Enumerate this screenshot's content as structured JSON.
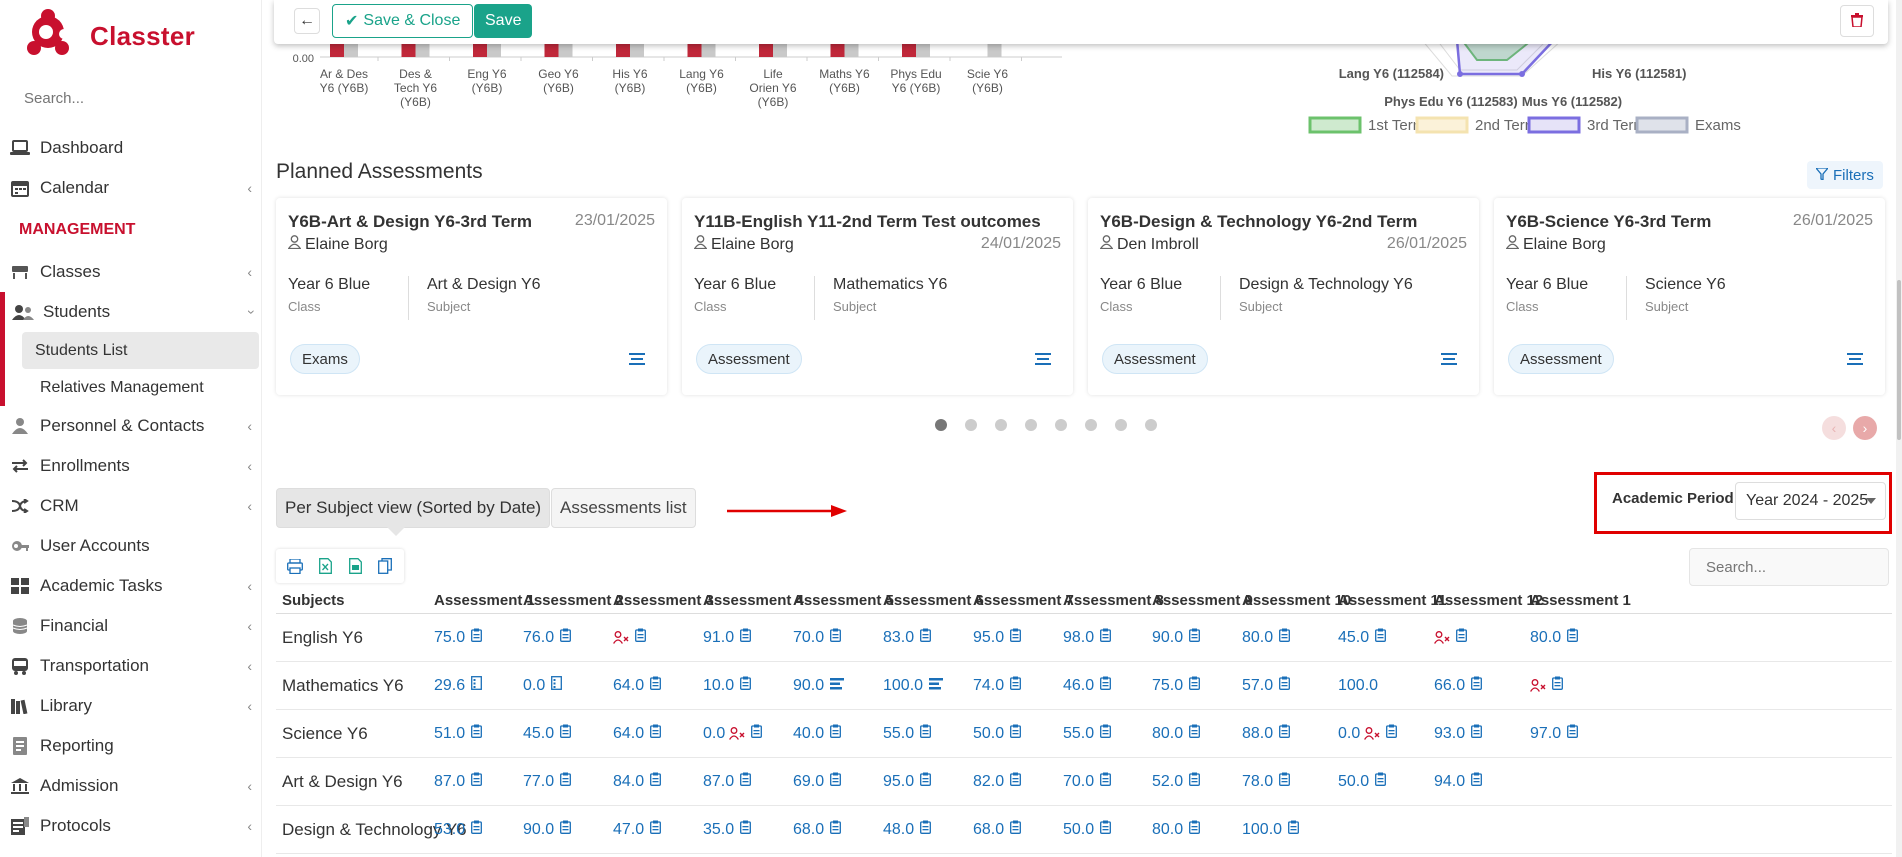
{
  "brand": {
    "name": "Classter"
  },
  "sidebar": {
    "search_placeholder": "Search...",
    "items": [
      {
        "label": "Dashboard",
        "icon": "laptop-icon",
        "chevron": false
      },
      {
        "label": "Calendar",
        "icon": "calendar-icon",
        "chevron": true
      }
    ],
    "section_label": "MANAGEMENT",
    "management_items": [
      {
        "label": "Classes",
        "icon": "chair-icon",
        "chevron": true
      },
      {
        "label": "Students",
        "icon": "users-icon",
        "chevron": true,
        "expanded": true
      },
      {
        "label": "Personnel & Contacts",
        "icon": "person-icon",
        "chevron": true
      },
      {
        "label": "Enrollments",
        "icon": "exchange-icon",
        "chevron": true
      },
      {
        "label": "CRM",
        "icon": "shuffle-icon",
        "chevron": true
      },
      {
        "label": "User Accounts",
        "icon": "key-icon",
        "chevron": false
      },
      {
        "label": "Academic Tasks",
        "icon": "grid-icon",
        "chevron": true
      },
      {
        "label": "Financial",
        "icon": "coins-icon",
        "chevron": true
      },
      {
        "label": "Transportation",
        "icon": "bus-icon",
        "chevron": true
      },
      {
        "label": "Library",
        "icon": "books-icon",
        "chevron": true
      },
      {
        "label": "Reporting",
        "icon": "report-icon",
        "chevron": false
      },
      {
        "label": "Admission",
        "icon": "institution-icon",
        "chevron": true
      },
      {
        "label": "Protocols",
        "icon": "protocol-icon",
        "chevron": true
      }
    ],
    "students_sub": [
      "Students List",
      "Relatives Management"
    ]
  },
  "toolbar": {
    "save_close_label": "Save & Close",
    "save_label": "Save"
  },
  "bar_chart": {
    "ytick": "0.00",
    "categories": [
      [
        "Ar & Des",
        "Y6 (Y6B)"
      ],
      [
        "Des &",
        "Tech Y6",
        "(Y6B)"
      ],
      [
        "Eng Y6",
        "(Y6B)"
      ],
      [
        "Geo Y6",
        "(Y6B)"
      ],
      [
        "His Y6",
        "(Y6B)"
      ],
      [
        "Lang Y6",
        "(Y6B)"
      ],
      [
        "Life",
        "Orien Y6",
        "(Y6B)"
      ],
      [
        "Maths Y6",
        "(Y6B)"
      ],
      [
        "Phys Edu",
        "Y6 (Y6B)"
      ],
      [
        "Scie Y6",
        "(Y6B)"
      ]
    ],
    "colors": {
      "red": "#c0283a",
      "grey": "#c9c9c9"
    }
  },
  "radar": {
    "labels": [
      "Lang Y6 (112584)",
      "His Y6 (112581)",
      "Phys Edu Y6 (112583)",
      "Mus Y6 (112582)"
    ],
    "legend": [
      {
        "label": "1st Term",
        "color": "#6cc26c",
        "fill": "#cfeacf"
      },
      {
        "label": "2nd Term",
        "color": "#f4e3b0",
        "fill": "#fbf2d9"
      },
      {
        "label": "3rd Term",
        "color": "#7b6ee0",
        "fill": "#e6e3f8"
      },
      {
        "label": "Exams",
        "color": "#a9b0c4",
        "fill": "#dfe2ea"
      }
    ]
  },
  "planned": {
    "title": "Planned Assessments",
    "filters_label": "Filters",
    "cards": [
      {
        "title": "Y6B-Art & Design Y6-3rd Term",
        "date": "23/01/2025",
        "teacher": "Elaine Borg",
        "class": "Year 6 Blue",
        "class_label": "Class",
        "subject": "Art & Design Y6",
        "subject_label": "Subject",
        "badge": "Exams"
      },
      {
        "title": "Y11B-English Y11-2nd Term Test outcomes",
        "date": "24/01/2025",
        "teacher": "Elaine Borg",
        "class": "Year 6 Blue",
        "class_label": "Class",
        "subject": "Mathematics Y6",
        "subject_label": "Subject",
        "badge": "Assessment"
      },
      {
        "title": "Y6B-Design & Technology Y6-2nd Term",
        "date": "26/01/2025",
        "teacher": "Den Imbroll",
        "class": "Year 6 Blue",
        "class_label": "Class",
        "subject": "Design & Technology Y6",
        "subject_label": "Subject",
        "badge": "Assessment"
      },
      {
        "title": "Y6B-Science Y6-3rd Term",
        "date": "26/01/2025",
        "teacher": "Elaine Borg",
        "class": "Year 6 Blue",
        "class_label": "Class",
        "subject": "Science Y6",
        "subject_label": "Subject",
        "badge": "Assessment"
      }
    ],
    "carousel_pages": 8,
    "carousel_active": 0,
    "prev_label": "‹",
    "next_label": "›"
  },
  "views": {
    "tab1": "Per Subject view (Sorted by Date)",
    "tab2": "Assessments list"
  },
  "academic_period": {
    "label": "Academic Period",
    "value": "Year 2024 - 2025"
  },
  "table": {
    "search_placeholder": "Search...",
    "headers": [
      "Subjects",
      "Assessment 1",
      "Assessment 2",
      "Assessment 3",
      "Assessment 4",
      "Assessment 5",
      "Assessment 6",
      "Assessment 7",
      "Assessment 8",
      "Assessment 9",
      "Assessment 10",
      "Assessment 11",
      "Assessment 12",
      "Assessment 1"
    ],
    "rows": [
      {
        "subject": "English Y6",
        "cells": [
          {
            "v": "75.0",
            "i": "clip"
          },
          {
            "v": "76.0",
            "i": "clip"
          },
          {
            "v": "",
            "i": "clip",
            "absent": true
          },
          {
            "v": "91.0",
            "i": "clip"
          },
          {
            "v": "70.0",
            "i": "clip"
          },
          {
            "v": "83.0",
            "i": "clip"
          },
          {
            "v": "95.0",
            "i": "clip"
          },
          {
            "v": "98.0",
            "i": "clip"
          },
          {
            "v": "90.0",
            "i": "clip"
          },
          {
            "v": "80.0",
            "i": "clip"
          },
          {
            "v": "45.0",
            "i": "clip"
          },
          {
            "v": "",
            "i": "clip",
            "absent": true
          },
          {
            "v": "80.0",
            "i": "clip"
          }
        ]
      },
      {
        "subject": "Mathematics Y6",
        "cells": [
          {
            "v": "29.6",
            "i": "list"
          },
          {
            "v": "0.0",
            "i": "list"
          },
          {
            "v": "64.0",
            "i": "clip"
          },
          {
            "v": "10.0",
            "i": "clip"
          },
          {
            "v": "90.0",
            "i": "bars"
          },
          {
            "v": "100.0",
            "i": "bars"
          },
          {
            "v": "74.0",
            "i": "clip"
          },
          {
            "v": "46.0",
            "i": "clip"
          },
          {
            "v": "75.0",
            "i": "clip"
          },
          {
            "v": "57.0",
            "i": "clip"
          },
          {
            "v": "100.0",
            "i": ""
          },
          {
            "v": "66.0",
            "i": "clip"
          },
          {
            "v": "",
            "i": "clip",
            "absent": true
          }
        ]
      },
      {
        "subject": "Science Y6",
        "cells": [
          {
            "v": "51.0",
            "i": "clip"
          },
          {
            "v": "45.0",
            "i": "clip"
          },
          {
            "v": "64.0",
            "i": "clip"
          },
          {
            "v": "0.0",
            "i": "clip",
            "absent": true
          },
          {
            "v": "40.0",
            "i": "clip"
          },
          {
            "v": "55.0",
            "i": "clip"
          },
          {
            "v": "50.0",
            "i": "clip"
          },
          {
            "v": "55.0",
            "i": "clip"
          },
          {
            "v": "80.0",
            "i": "clip"
          },
          {
            "v": "88.0",
            "i": "clip"
          },
          {
            "v": "0.0",
            "i": "clip",
            "absent": true
          },
          {
            "v": "93.0",
            "i": "clip"
          },
          {
            "v": "97.0",
            "i": "clip"
          }
        ]
      },
      {
        "subject": "Art & Design Y6",
        "cells": [
          {
            "v": "87.0",
            "i": "clip"
          },
          {
            "v": "77.0",
            "i": "clip"
          },
          {
            "v": "84.0",
            "i": "clip"
          },
          {
            "v": "87.0",
            "i": "clip"
          },
          {
            "v": "69.0",
            "i": "clip"
          },
          {
            "v": "95.0",
            "i": "clip"
          },
          {
            "v": "82.0",
            "i": "clip"
          },
          {
            "v": "70.0",
            "i": "clip"
          },
          {
            "v": "52.0",
            "i": "clip"
          },
          {
            "v": "78.0",
            "i": "clip"
          },
          {
            "v": "50.0",
            "i": "clip"
          },
          {
            "v": "94.0",
            "i": "clip"
          }
        ]
      },
      {
        "subject": "Design & Technology Y6",
        "cells": [
          {
            "v": "53.0",
            "i": "clip"
          },
          {
            "v": "90.0",
            "i": "clip"
          },
          {
            "v": "47.0",
            "i": "clip"
          },
          {
            "v": "35.0",
            "i": "clip"
          },
          {
            "v": "68.0",
            "i": "clip"
          },
          {
            "v": "48.0",
            "i": "clip"
          },
          {
            "v": "68.0",
            "i": "clip"
          },
          {
            "v": "50.0",
            "i": "clip"
          },
          {
            "v": "80.0",
            "i": "clip"
          },
          {
            "v": "100.0",
            "i": "clip"
          }
        ]
      }
    ]
  },
  "colors": {
    "accent": "#c8102e",
    "teal": "#1aa38a",
    "link": "#1a6fb8"
  }
}
